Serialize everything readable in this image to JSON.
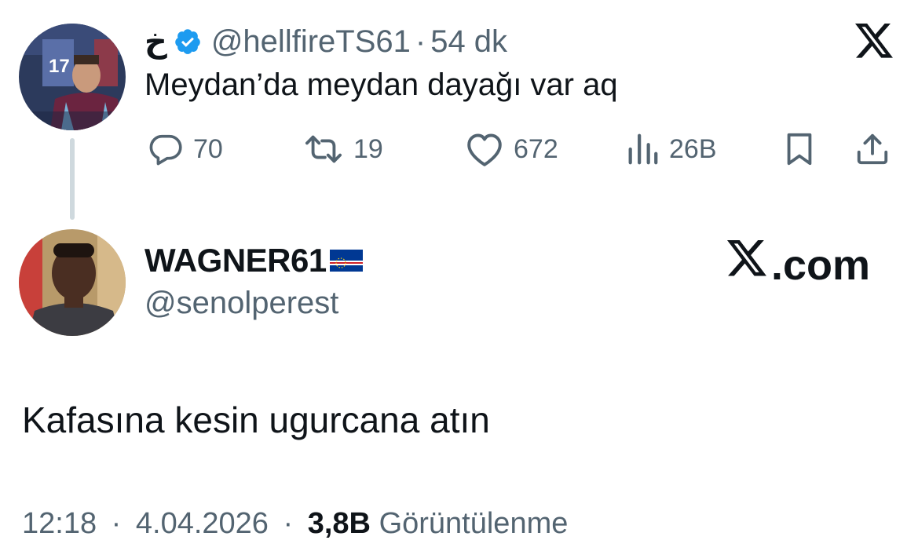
{
  "quoted_tweet": {
    "display_name": "خ",
    "handle": "@hellfireTS61",
    "separator": "·",
    "time_ago": "54 dk",
    "text": "Meydan’da meydan dayağı var aq",
    "actions": {
      "replies": "70",
      "reposts": "19",
      "likes": "672",
      "views": "26B"
    }
  },
  "reply_tweet": {
    "display_name": "WAGNER61",
    "handle": "@senolperest",
    "text": "Kafasına kesin ugurcana atın",
    "footer": {
      "time": "12:18",
      "sep1": "·",
      "date": "4.04.2026",
      "sep2": "·",
      "views_count": "3,8B",
      "views_label": "Görüntülenme"
    }
  },
  "brand": {
    "domain_suffix": ".com"
  },
  "icons": {
    "verified": "verified-badge-icon",
    "x_logo": "x-logo-icon",
    "reply": "reply-icon",
    "repost": "repost-icon",
    "like": "heart-icon",
    "views": "analytics-icon",
    "bookmark": "bookmark-icon",
    "share": "share-icon",
    "flag": "cape-verde-flag-icon"
  },
  "colors": {
    "text_primary": "#0f1419",
    "text_secondary": "#536471",
    "verified_blue": "#1d9bf0",
    "thread_line": "#cfd9de"
  }
}
